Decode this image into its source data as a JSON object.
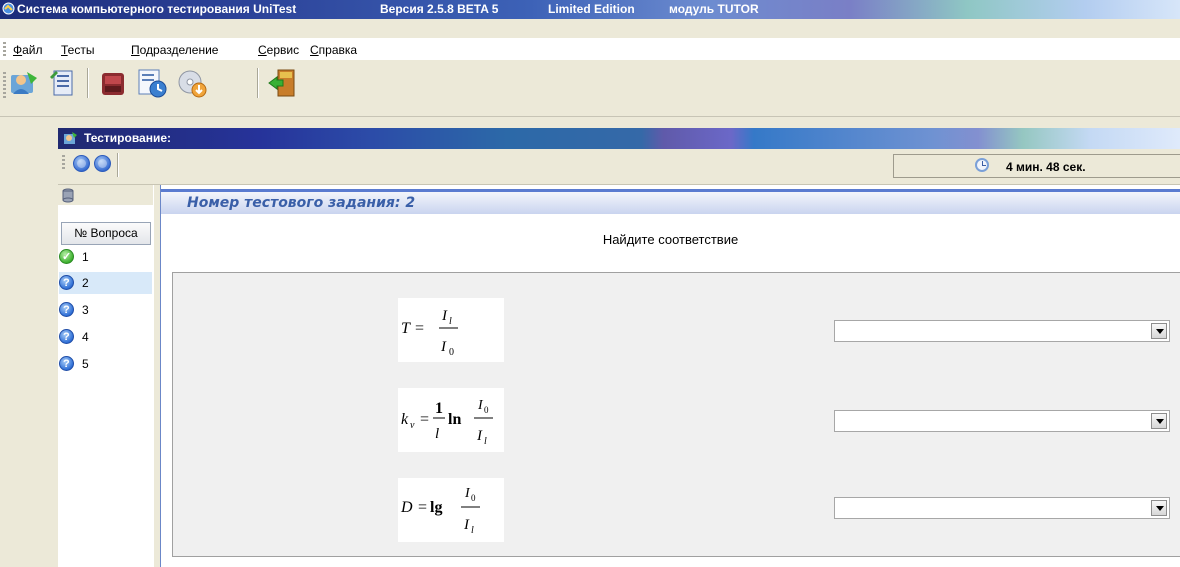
{
  "window": {
    "title_app": "Система компьютерного тестирования UniTest",
    "title_version": "Версия 2.5.8 BETA 5",
    "title_edition": "Limited Edition",
    "title_module": "модуль TUTOR"
  },
  "menu": {
    "items": [
      "Файл",
      "Тесты",
      "Подразделение",
      "Сервис",
      "Справка"
    ]
  },
  "toolbar": {
    "buttons": [
      "users-icon",
      "test-list-icon",
      "archive-icon",
      "schedule-icon",
      "cd-install-icon",
      "exit-door-icon"
    ]
  },
  "testing_window": {
    "title": "Тестирование:",
    "timer": "4 мин. 48 сек."
  },
  "questions": {
    "header": "№ Вопроса",
    "items": [
      {
        "num": "1",
        "status": "answered"
      },
      {
        "num": "2",
        "status": "unanswered",
        "selected": true
      },
      {
        "num": "3",
        "status": "unanswered"
      },
      {
        "num": "4",
        "status": "unanswered"
      },
      {
        "num": "5",
        "status": "unanswered"
      }
    ]
  },
  "task": {
    "header_label": "Номер тестового задания:",
    "header_number": "2",
    "title": "Найдите соответствие",
    "formulas": [
      {
        "lhs": "T",
        "rhs_num": "I",
        "rhs_num_sub": "l",
        "rhs_den": "I",
        "rhs_den_sub": "0"
      },
      {
        "lhs": "k",
        "lhs_sub": "ν",
        "coef_num": "1",
        "coef_den": "l",
        "func": "ln",
        "frac_num": "I",
        "frac_num_sub": "0",
        "frac_den": "I",
        "frac_den_sub": "l"
      },
      {
        "lhs": "D",
        "func": "lg",
        "frac_num": "I",
        "frac_num_sub": "0",
        "frac_den": "I",
        "frac_den_sub": "l"
      }
    ],
    "answer_values": [
      "",
      "",
      ""
    ]
  }
}
